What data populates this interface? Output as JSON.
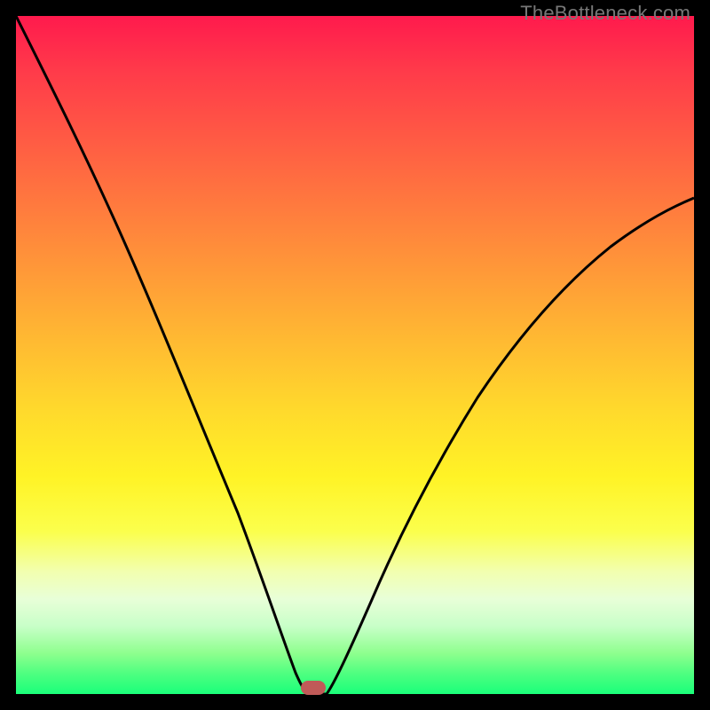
{
  "watermark": "TheBottleneck.com",
  "chart_data": {
    "type": "line",
    "title": "",
    "xlabel": "",
    "ylabel": "",
    "xlim": [
      0,
      100
    ],
    "ylim": [
      0,
      100
    ],
    "grid": false,
    "legend": false,
    "series": [
      {
        "name": "left-branch",
        "x": [
          0,
          4,
          8,
          12,
          16,
          20,
          24,
          28,
          32,
          36,
          38,
          40,
          41,
          42
        ],
        "y": [
          100,
          90,
          80,
          70,
          60,
          50,
          40,
          30,
          20,
          10,
          5,
          2,
          0.5,
          0
        ]
      },
      {
        "name": "right-branch",
        "x": [
          45,
          48,
          52,
          56,
          60,
          64,
          68,
          72,
          76,
          80,
          84,
          88,
          92,
          96,
          100
        ],
        "y": [
          0,
          4,
          10,
          18,
          26,
          34,
          42,
          49,
          55,
          60,
          64,
          67,
          70,
          72,
          74
        ]
      }
    ],
    "marker": {
      "x_pct": 43.5,
      "y_pct": 1.0
    },
    "colors": {
      "curve": "#000000",
      "marker": "#c05a58",
      "gradient_top": "#ff1a4d",
      "gradient_bottom": "#1aff7a"
    }
  }
}
